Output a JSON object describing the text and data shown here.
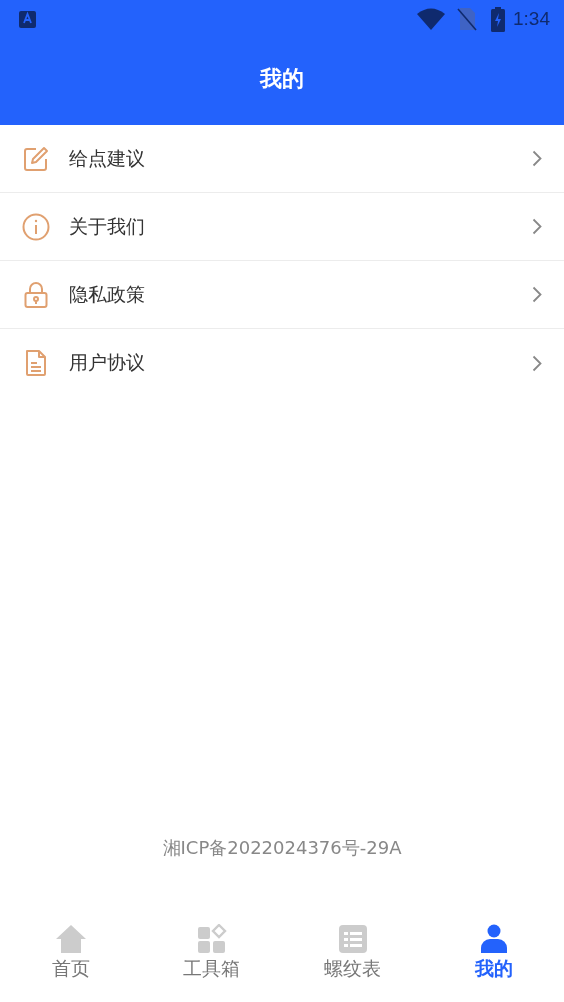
{
  "status_bar": {
    "time": "1:34"
  },
  "header": {
    "title": "我的"
  },
  "menu": [
    {
      "label": "给点建议",
      "kind": "edit"
    },
    {
      "label": "关于我们",
      "kind": "info"
    },
    {
      "label": "隐私政策",
      "kind": "lock"
    },
    {
      "label": "用户协议",
      "kind": "document"
    }
  ],
  "footer": {
    "text": "湘ICP备2022024376号-29A"
  },
  "tabs": [
    {
      "label": "首页",
      "kind": "home",
      "selected": false
    },
    {
      "label": "工具箱",
      "kind": "tools",
      "selected": false
    },
    {
      "label": "螺纹表",
      "kind": "table",
      "selected": false
    },
    {
      "label": "我的",
      "kind": "person",
      "selected": true
    }
  ]
}
